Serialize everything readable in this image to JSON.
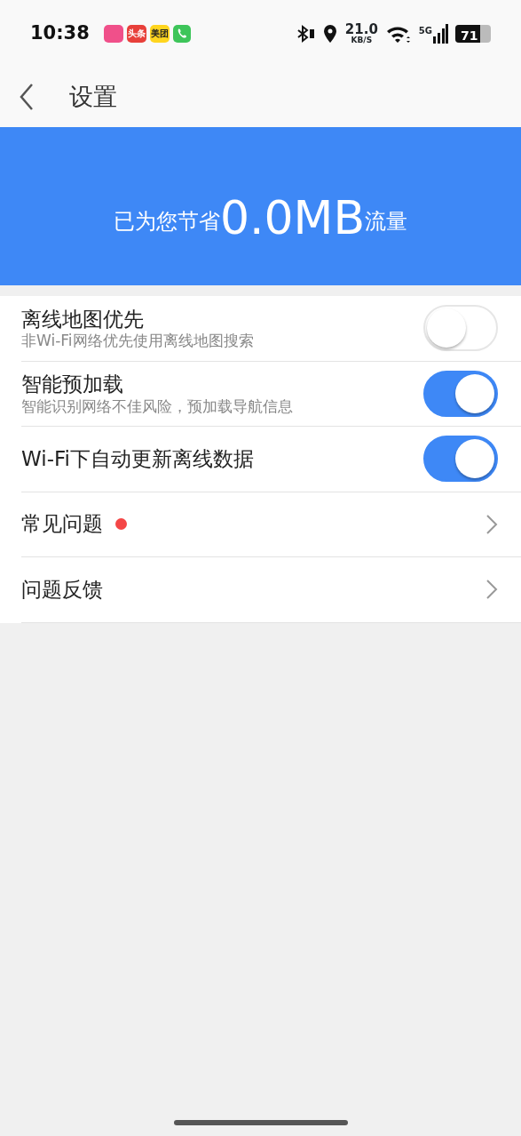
{
  "status_bar": {
    "time": "10:38",
    "notifications": [
      {
        "kind": "app"
      },
      {
        "kind": "label",
        "label": "头条",
        "color": "#e8403a"
      },
      {
        "kind": "label",
        "label": "美团",
        "color": "#ffd51f"
      },
      {
        "kind": "phone"
      }
    ],
    "net_speed": "21.0",
    "net_unit": "KB/S",
    "network": "5G",
    "battery": "71"
  },
  "header": {
    "title": "设置"
  },
  "banner": {
    "prefix": "已为您节省",
    "amount": "0.0MB",
    "suffix": "流量"
  },
  "settings": [
    {
      "kind": "toggle",
      "title": "离线地图优先",
      "subtitle": "非Wi-Fi网络优先使用离线地图搜索",
      "on": false
    },
    {
      "kind": "toggle",
      "title": "智能预加载",
      "subtitle": "智能识别网络不佳风险，预加载导航信息",
      "on": true
    },
    {
      "kind": "toggle",
      "title": "Wi-Fi下自动更新离线数据",
      "on": true
    },
    {
      "kind": "link",
      "title": "常见问题",
      "badge": true
    },
    {
      "kind": "link",
      "title": "问题反馈",
      "badge": false
    }
  ]
}
